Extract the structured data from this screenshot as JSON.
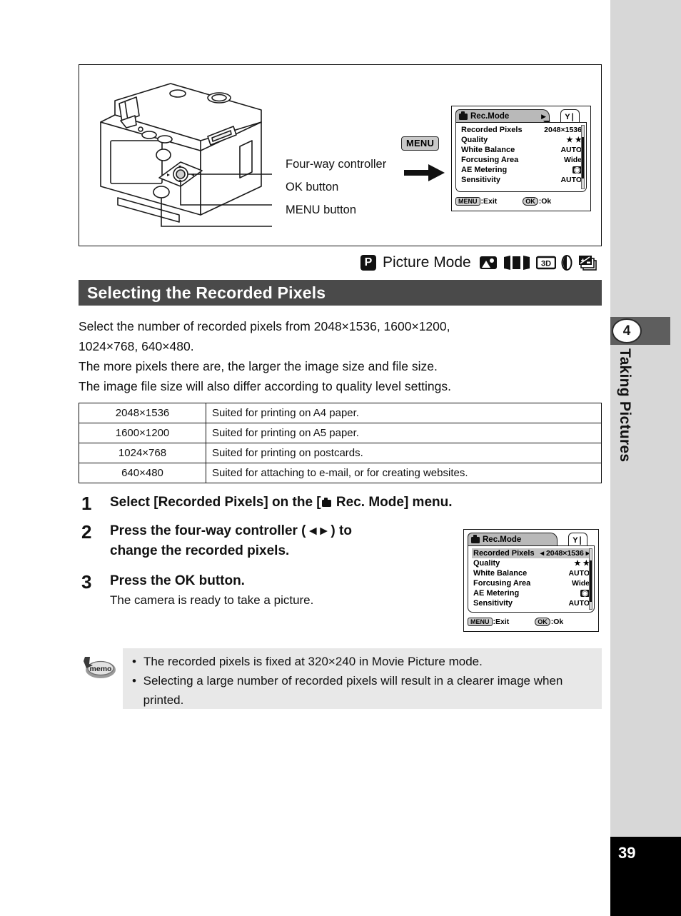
{
  "page": {
    "number": "39",
    "chapter_number": "4",
    "chapter_title": "Taking Pictures"
  },
  "illustration": {
    "callouts": {
      "four_way": "Four-way controller",
      "ok_button": "OK button",
      "menu_button": "MENU button"
    },
    "menu_badge": "MENU"
  },
  "lcd_top": {
    "tab_title": "Rec.Mode",
    "tab_arrow": "▶",
    "tools_icon": "Y❘",
    "rows": [
      {
        "label": "Recorded Pixels",
        "value": "2048×1536",
        "selected": false
      },
      {
        "label": "Quality",
        "value": "★ ★",
        "selected": false
      },
      {
        "label": "White Balance",
        "value": "AUTO",
        "selected": false
      },
      {
        "label": "Forcusing Area",
        "value": "Wide",
        "selected": false
      },
      {
        "label": "AE Metering",
        "value": "◉",
        "selected": false
      },
      {
        "label": "Sensitivity",
        "value": "AUTO",
        "selected": false
      }
    ],
    "footer": {
      "menu_key": "MENU",
      "menu_action": ":Exit",
      "ok_key": "OK",
      "ok_action": ":Ok"
    }
  },
  "lcd_bottom": {
    "tab_title": "Rec.Mode",
    "tools_icon": "Y❘",
    "rows": [
      {
        "label": "Recorded Pixels",
        "value": "◂ 2048×1536 ▸",
        "selected": true
      },
      {
        "label": "Quality",
        "value": "★ ★",
        "selected": false
      },
      {
        "label": "White Balance",
        "value": "AUTO",
        "selected": false
      },
      {
        "label": "Forcusing Area",
        "value": "Wide",
        "selected": false
      },
      {
        "label": "AE Metering",
        "value": "◉",
        "selected": false
      },
      {
        "label": "Sensitivity",
        "value": "AUTO",
        "selected": false
      }
    ],
    "footer": {
      "menu_key": "MENU",
      "menu_action": ":Exit",
      "ok_key": "OK",
      "ok_action": ":Ok"
    }
  },
  "mode_line": {
    "badge": "P",
    "label": "Picture Mode",
    "icons": [
      "landscape-icon",
      "panorama-icon",
      "3d-icon",
      "filter-icon",
      "exposure-bracket-icon"
    ],
    "three_d_label": "3D"
  },
  "heading": "Selecting the Recorded Pixels",
  "intro": {
    "line1": "Select the number of recorded pixels from 2048×1536, 1600×1200,",
    "line2": "1024×768, 640×480.",
    "line3": "The more pixels there are, the larger the image size and file size.",
    "line4": "The image file size will also differ according to quality level settings."
  },
  "table": {
    "rows": [
      {
        "size": "2048×1536",
        "desc": "Suited for printing on A4 paper."
      },
      {
        "size": "1600×1200",
        "desc": "Suited for printing on A5 paper."
      },
      {
        "size": "1024×768",
        "desc": "Suited for printing on postcards."
      },
      {
        "size": "640×480",
        "desc": "Suited for attaching to e-mail, or for creating websites."
      }
    ]
  },
  "steps": [
    {
      "num": "1",
      "text_before": "Select [Recorded Pixels] on the [",
      "text_after": " Rec. Mode] menu."
    },
    {
      "num": "2",
      "line1": "Press the four-way controller ( ◂ ▸ ) to",
      "line2": "change the recorded pixels."
    },
    {
      "num": "3",
      "line1": "Press the OK button.",
      "sub": "The camera is ready to take a picture."
    }
  ],
  "memo": {
    "icon_label": "memo",
    "items": [
      "The recorded pixels is fixed at 320×240 in Movie Picture mode.",
      "Selecting a large number of recorded pixels will result in a clearer image when printed."
    ]
  }
}
